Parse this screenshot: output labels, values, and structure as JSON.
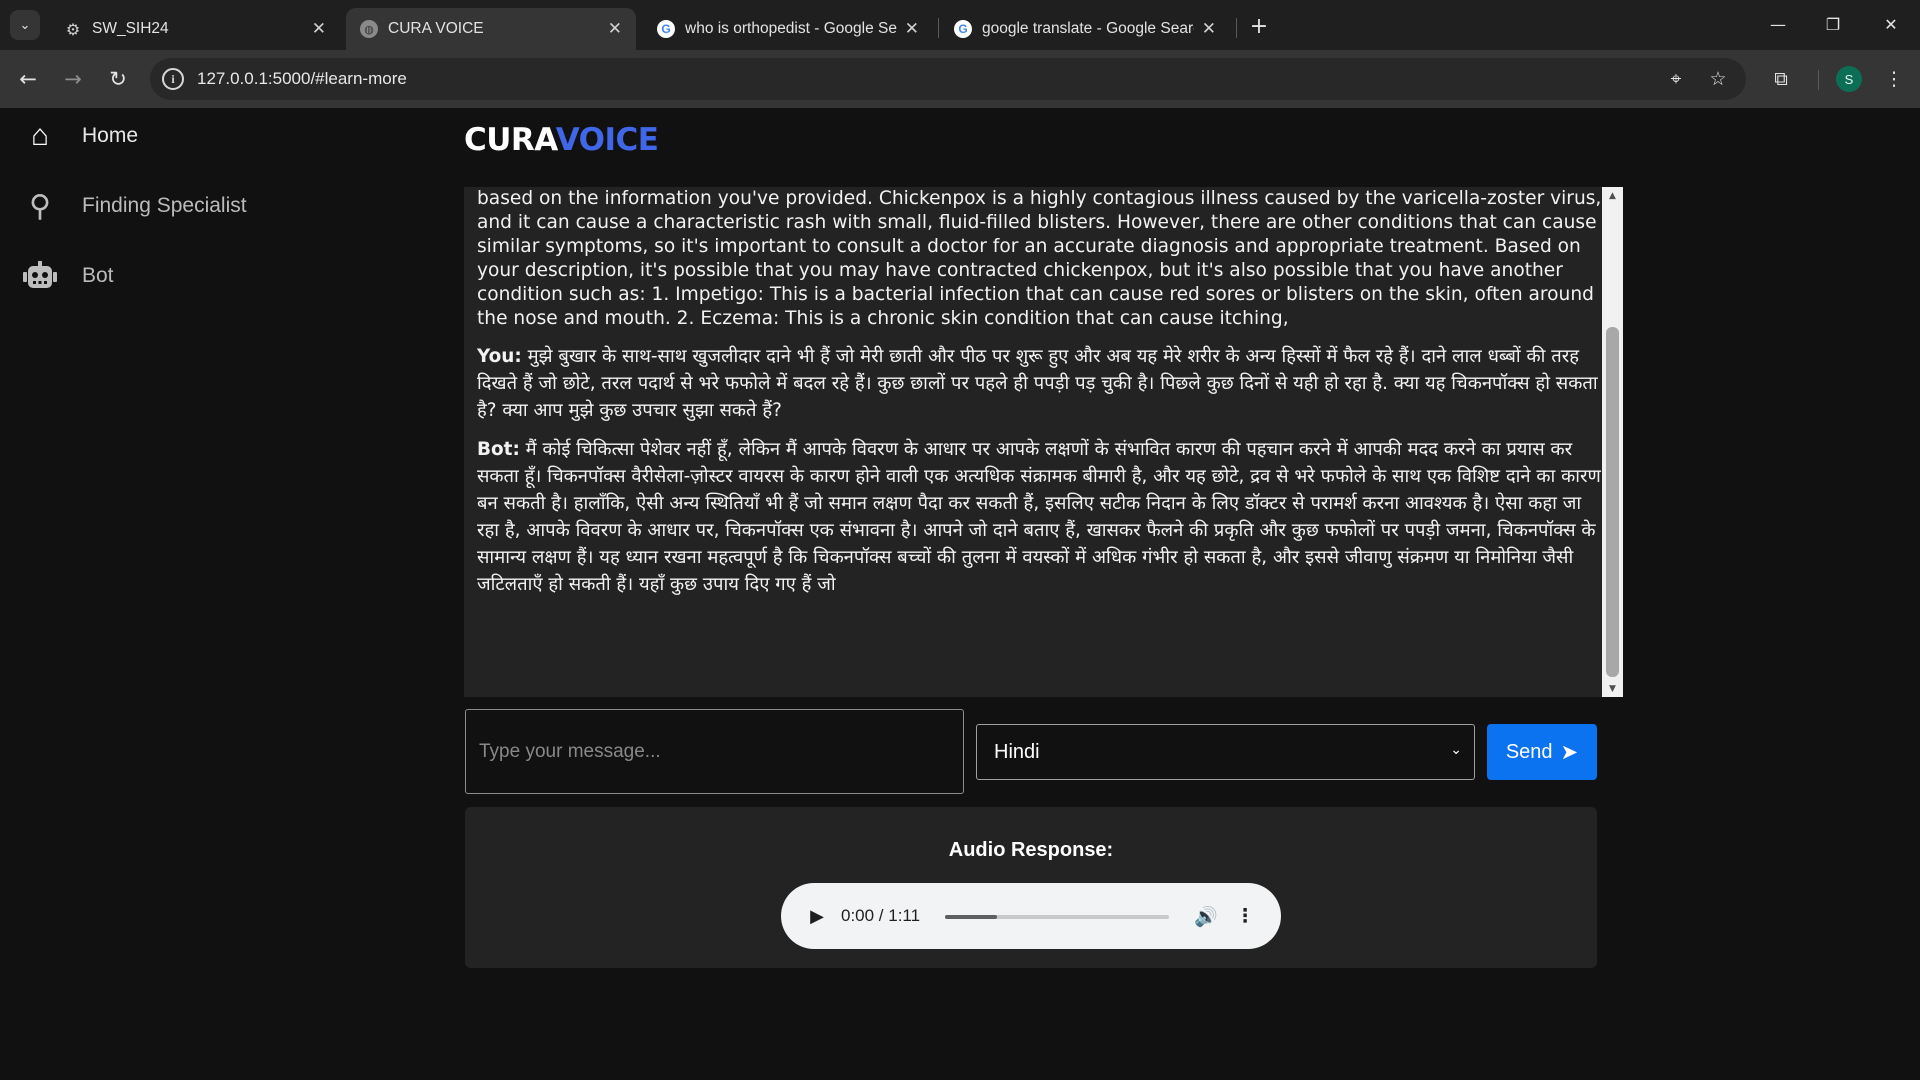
{
  "browser": {
    "tabs": [
      {
        "title": "SW_SIH24",
        "favicon": "gear-icon",
        "active": false
      },
      {
        "title": "CURA VOICE",
        "favicon": "globe-icon",
        "active": true
      },
      {
        "title": "who is orthopedist - Google Sea",
        "favicon": "google-icon",
        "active": false
      },
      {
        "title": "google translate - Google Searc",
        "favicon": "google-icon",
        "active": false
      }
    ],
    "url": "127.0.0.1:5000/#learn-more",
    "profile_initial": "S"
  },
  "sidebar": {
    "items": [
      {
        "label": "Home",
        "icon": "home-icon"
      },
      {
        "label": "Finding Specialist",
        "icon": "search-icon"
      },
      {
        "label": "Bot",
        "icon": "robot-icon"
      }
    ]
  },
  "brand": {
    "part1": "CURA",
    "part2": "VOICE",
    "accent": "#3f67e8"
  },
  "chat": {
    "messages": [
      {
        "speaker": "",
        "text": "based on the information you've provided. Chickenpox is a highly contagious illness caused by the varicella-zoster virus, and it can cause a characteristic rash with small, fluid-filled blisters. However, there are other conditions that can cause similar symptoms, so it's important to consult a doctor for an accurate diagnosis and appropriate treatment. Based on your description, it's possible that you may have contracted chickenpox, but it's also possible that you have another condition such as: 1. Impetigo: This is a bacterial infection that can cause red sores or blisters on the skin, often around the nose and mouth. 2. Eczema: This is a chronic skin condition that can cause itching,"
      },
      {
        "speaker": "You:",
        "text": "मुझे बुखार के साथ-साथ खुजलीदार दाने भी हैं जो मेरी छाती और पीठ पर शुरू हुए और अब यह मेरे शरीर के अन्य हिस्सों में फैल रहे हैं। दाने लाल धब्बों की तरह दिखते हैं जो छोटे, तरल पदार्थ से भरे फफोले में बदल रहे हैं। कुछ छालों पर पहले ही पपड़ी पड़ चुकी है। पिछले कुछ दिनों से यही हो रहा है. क्या यह चिकनपॉक्स हो सकता है? क्या आप मुझे कुछ उपचार सुझा सकते हैं?"
      },
      {
        "speaker": "Bot:",
        "text": "मैं कोई चिकित्सा पेशेवर नहीं हूँ, लेकिन मैं आपके विवरण के आधार पर आपके लक्षणों के संभावित कारण की पहचान करने में आपकी मदद करने का प्रयास कर सकता हूँ। चिकनपॉक्स वैरीसेला-ज़ोस्टर वायरस के कारण होने वाली एक अत्यधिक संक्रामक बीमारी है, और यह छोटे, द्रव से भरे फफोले के साथ एक विशिष्ट दाने का कारण बन सकती है। हालाँकि, ऐसी अन्य स्थितियाँ भी हैं जो समान लक्षण पैदा कर सकती हैं, इसलिए सटीक निदान के लिए डॉक्टर से परामर्श करना आवश्यक है। ऐसा कहा जा रहा है, आपके विवरण के आधार पर, चिकनपॉक्स एक संभावना है। आपने जो दाने बताए हैं, खासकर फैलने की प्रकृति और कुछ फफोलों पर पपड़ी जमना, चिकनपॉक्स के सामान्य लक्षण हैं। यह ध्यान रखना महत्वपूर्ण है कि चिकनपॉक्स बच्चों की तुलना में वयस्कों में अधिक गंभीर हो सकता है, और इससे जीवाणु संक्रमण या निमोनिया जैसी जटिलताएँ हो सकती हैं। यहाँ कुछ उपाय दिए गए हैं जो"
      }
    ]
  },
  "composer": {
    "placeholder": "Type your message...",
    "language": "Hindi",
    "send_label": "Send"
  },
  "audio": {
    "title": "Audio Response:",
    "time": "0:00 / 1:11",
    "progress_fraction": 0.23
  }
}
